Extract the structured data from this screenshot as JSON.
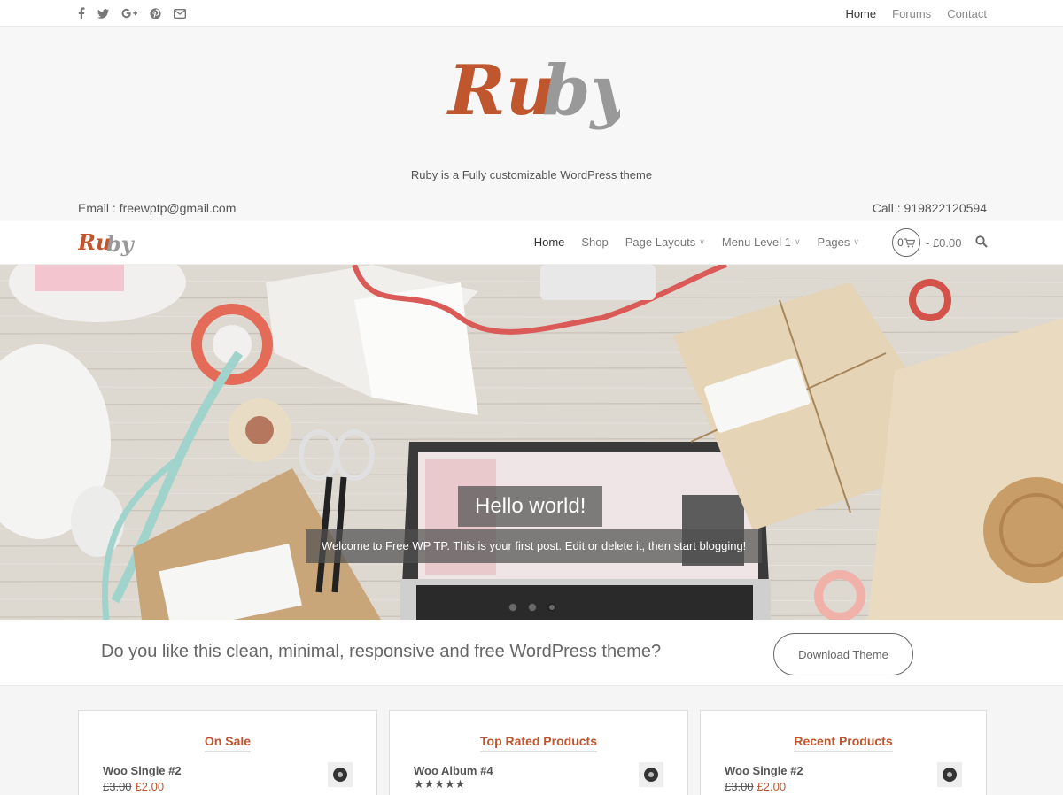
{
  "topbar": {
    "social_icons": [
      "facebook-icon",
      "twitter-icon",
      "google-plus-icon",
      "pinterest-icon",
      "email-icon"
    ],
    "nav": [
      "Home",
      "Forums",
      "Contact"
    ]
  },
  "header": {
    "logo_text_1": "Ru",
    "logo_text_2": "by",
    "tagline": "Ruby is a Fully customizable WordPress theme",
    "email": "Email : freewptp@gmail.com",
    "phone": "Call : 919822120594"
  },
  "mainnav": {
    "items": [
      {
        "label": "Home"
      },
      {
        "label": "Shop"
      },
      {
        "label": "Page Layouts"
      },
      {
        "label": "Menu Level 1"
      },
      {
        "label": "Pages"
      }
    ],
    "cart_count": "0",
    "cart_total": "- £0.00"
  },
  "hero": {
    "title": "Hello world!",
    "subtitle": "Welcome to Free WP TP. This is your first post. Edit or delete it, then start blogging!"
  },
  "cta": {
    "text": "Do you like this clean, minimal, responsive and free WordPress theme?",
    "button": "Download Theme"
  },
  "widgets": [
    {
      "title": "On Sale",
      "product": "Woo Single #2",
      "old_price": "£3.00",
      "new_price": "£2.00"
    },
    {
      "title": "Top Rated Products",
      "product": "Woo Album #4",
      "rating": 5
    },
    {
      "title": "Recent Products",
      "product": "Woo Single #2",
      "old_price": "£3.00",
      "new_price": "£2.00"
    }
  ],
  "colors": {
    "accent": "#c0562e",
    "logo_grey": "#999999"
  }
}
